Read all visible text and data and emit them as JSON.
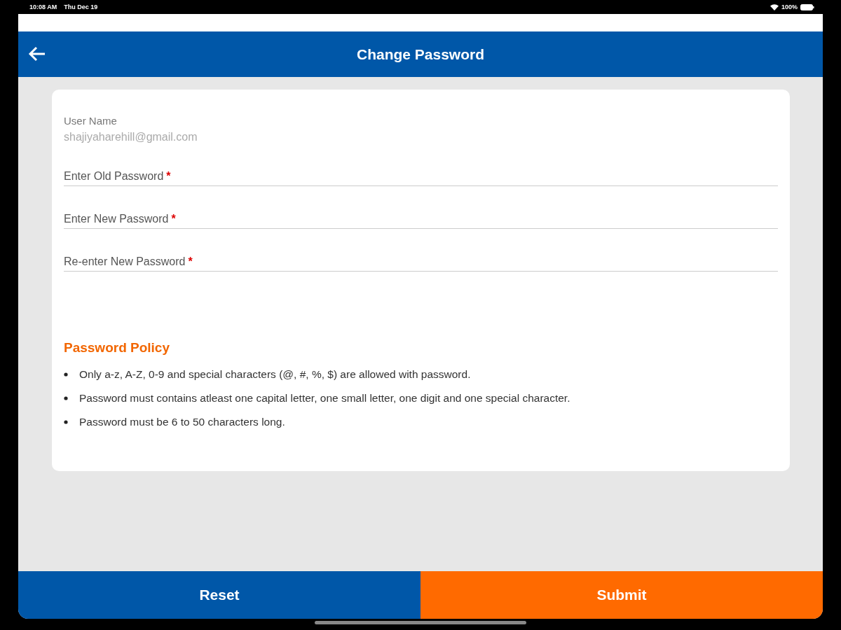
{
  "status_bar": {
    "time": "10:08 AM",
    "date": "Thu Dec 19",
    "battery": "100%"
  },
  "header": {
    "title": "Change Password"
  },
  "user": {
    "label": "User Name",
    "value": "shajiyaharehill@gmail.com"
  },
  "fields": [
    {
      "placeholder": "Enter Old Password",
      "required_mark": "*"
    },
    {
      "placeholder": "Enter New Password",
      "required_mark": "*"
    },
    {
      "placeholder": "Re-enter New Password",
      "required_mark": "*"
    }
  ],
  "policy": {
    "title": "Password Policy",
    "rules": [
      "Only a-z, A-Z, 0-9 and special characters (@, #, %, $) are allowed with password.",
      "Password must contains atleast one capital letter, one small letter, one digit and one special character.",
      "Password must be 6 to 50 characters long."
    ]
  },
  "buttons": [
    {
      "label": "Reset",
      "kind": "secondary"
    },
    {
      "label": "Submit",
      "kind": "primary"
    }
  ]
}
